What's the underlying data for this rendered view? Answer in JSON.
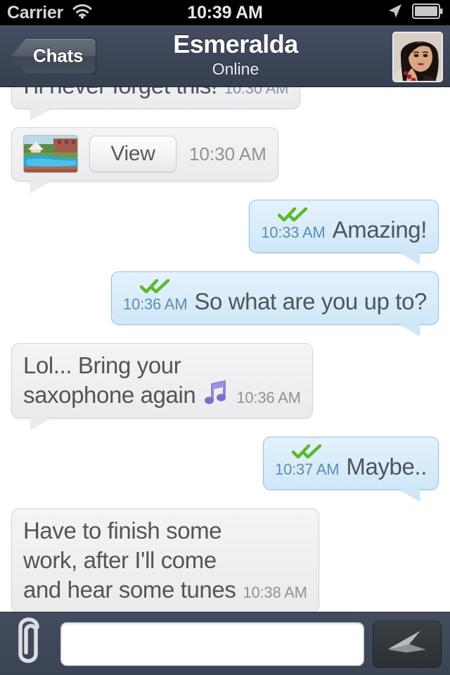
{
  "status_bar": {
    "carrier": "Carrier",
    "time": "10:39 AM",
    "wifi_icon": "wifi-icon",
    "location_icon": "location-arrow-icon",
    "battery_icon": "battery-full-icon"
  },
  "nav_bar": {
    "back_label": "Chats",
    "title": "Esmeralda",
    "subtitle": "Online",
    "avatar_name": "contact-avatar",
    "background_color": "#3d4658"
  },
  "colors": {
    "incoming_bubble": "#e9ebed",
    "outgoing_bubble": "#cfe7f8",
    "outgoing_border": "#8fc4e8",
    "tick_green": "#5cb82c",
    "chat_background": "#ffffff",
    "navbar": "#3d4658",
    "outgoing_time": "#5b8cb0",
    "incoming_time": "#8e9397"
  },
  "messages": [
    {
      "id": "msg-1",
      "direction": "incoming",
      "type": "text",
      "text": "I'll never forget this!",
      "time": "10:30 AM"
    },
    {
      "id": "msg-2",
      "direction": "incoming",
      "type": "attachment",
      "thumbnail_name": "resort-pool-thumbnail",
      "button_label": "View",
      "time": "10:30 AM"
    },
    {
      "id": "msg-3",
      "direction": "outgoing",
      "type": "text",
      "text": "Amazing!",
      "time": "10:33 AM",
      "status_icon": "double-check-icon"
    },
    {
      "id": "msg-4",
      "direction": "outgoing",
      "type": "text",
      "text": "So what are you up to?",
      "time": "10:36 AM",
      "status_icon": "double-check-icon"
    },
    {
      "id": "msg-5",
      "direction": "incoming",
      "type": "text",
      "text": "Lol... Bring your\nsaxophone again",
      "emoji": "music-note-emoji",
      "time": "10:36 AM"
    },
    {
      "id": "msg-6",
      "direction": "outgoing",
      "type": "text",
      "text": "Maybe..",
      "time": "10:37 AM",
      "status_icon": "double-check-icon"
    },
    {
      "id": "msg-7",
      "direction": "incoming",
      "type": "text",
      "text": "Have to finish some\nwork, after I'll come\nand hear some tunes",
      "time": "10:38 AM"
    }
  ],
  "input_bar": {
    "attach_icon": "paperclip-icon",
    "message_value": "",
    "message_placeholder": "",
    "send_icon": "send-paper-plane-icon"
  }
}
